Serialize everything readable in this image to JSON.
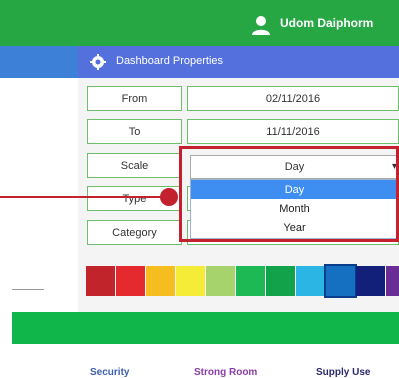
{
  "header": {
    "user_name": "Udom Daiphorm"
  },
  "panel": {
    "title": "Dashboard Properties"
  },
  "form": {
    "from_label": "From",
    "from_value": "02/11/2016",
    "to_label": "To",
    "to_value": "11/11/2016",
    "scale_label": "Scale",
    "scale_value": "Day",
    "type_label": "Type",
    "category_label": "Category"
  },
  "dropdown": {
    "options": [
      "Day",
      "Month",
      "Year"
    ]
  },
  "palette": [
    "#c2242c",
    "#e52a2f",
    "#f5bd20",
    "#f4ec36",
    "#a6d36b",
    "#1db954",
    "#12a24a",
    "#2bb5e5",
    "#1570c1",
    "#13207a",
    "#6a2c95"
  ],
  "links": [
    "Security",
    "Strong Room",
    "Supply Use"
  ],
  "colors": {
    "accent_green": "#27a744",
    "brand_blue": "#5470dd",
    "highlight_red": "#c4212f"
  }
}
